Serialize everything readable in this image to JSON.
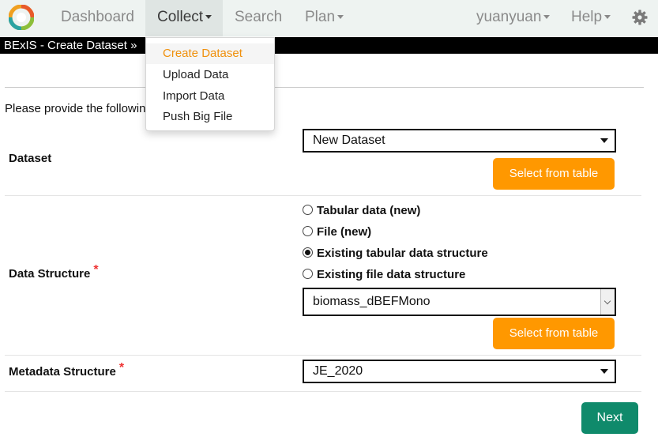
{
  "nav": {
    "dashboard": "Dashboard",
    "collect": "Collect",
    "search": "Search",
    "plan": "Plan",
    "user": "yuanyuan",
    "help": "Help",
    "logo_icon": "bexis-logo-icon",
    "settings_icon": "gear-icon"
  },
  "titlebar": {
    "text": "BExIS - Create Dataset »"
  },
  "dropdown": {
    "items": [
      {
        "label": "Create Dataset"
      },
      {
        "label": "Upload Data"
      },
      {
        "label": "Import Data"
      },
      {
        "label": "Push Big File"
      }
    ]
  },
  "intro": {
    "text": "Please provide the followin"
  },
  "dataset": {
    "label": "Dataset",
    "selected": "New Dataset",
    "select_button": "Select from table"
  },
  "structure": {
    "label": "Data Structure",
    "required": "*",
    "options": [
      {
        "label": "Tabular data (new)",
        "checked": false
      },
      {
        "label": "File (new)",
        "checked": false
      },
      {
        "label": "Existing tabular data structure",
        "checked": true
      },
      {
        "label": "Existing file data structure",
        "checked": false
      }
    ],
    "selected": "biomass_dBEFMono",
    "select_button": "Select from table"
  },
  "metadata": {
    "label": "Metadata Structure",
    "required": "*",
    "selected": "JE_2020"
  },
  "next_button": "Next",
  "colors": {
    "accent_orange": "#ff9800",
    "next_green": "#0f8a6b",
    "menu_active": "#f0900c",
    "navbar_bg": "#eef3f1"
  }
}
